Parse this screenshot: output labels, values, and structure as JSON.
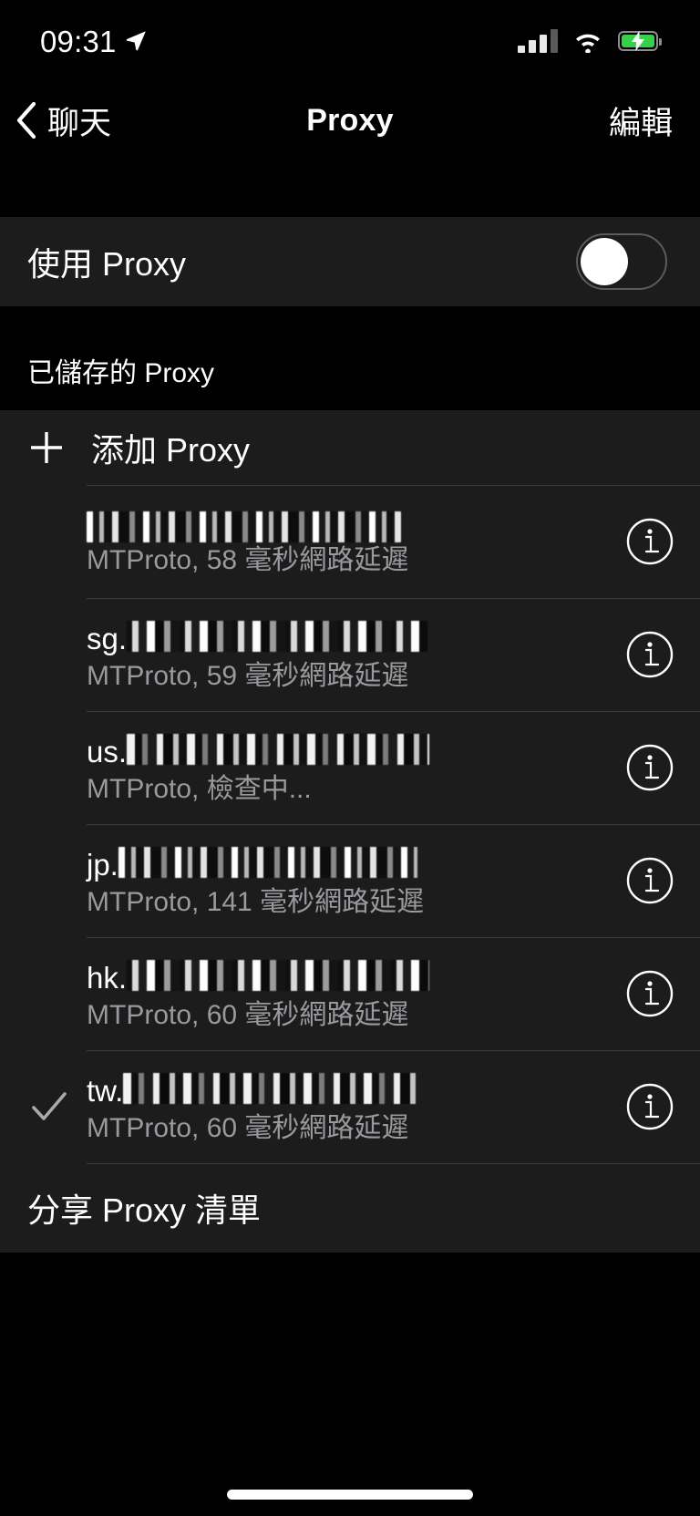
{
  "status_bar": {
    "time": "09:31",
    "location_icon": "location-arrow-icon",
    "signal_icon": "cellular-signal-icon",
    "wifi_icon": "wifi-icon",
    "battery_icon": "battery-charging-icon",
    "battery_color": "#37d04a"
  },
  "nav": {
    "back_label": "聊天",
    "title": "Proxy",
    "edit_label": "編輯"
  },
  "settings": {
    "use_proxy_label": "使用 Proxy",
    "use_proxy_enabled": false
  },
  "saved_section": {
    "header": "已儲存的 Proxy",
    "add_label": "添加 Proxy",
    "add_icon": "plus-icon"
  },
  "proxies": [
    {
      "host_prefix": "",
      "host_redacted": true,
      "host_redacted_width": 345,
      "detail": "MTProto, 58 毫秒網路延遲",
      "selected": false,
      "info_icon": "info-circle-icon"
    },
    {
      "host_prefix": "sg.",
      "host_redacted": true,
      "host_redacted_width": 330,
      "detail": "MTProto, 59 毫秒網路延遲",
      "selected": false,
      "info_icon": "info-circle-icon"
    },
    {
      "host_prefix": "us.",
      "host_redacted": true,
      "host_redacted_width": 332,
      "detail": "MTProto, 檢查中...",
      "selected": false,
      "info_icon": "info-circle-icon"
    },
    {
      "host_prefix": "jp.",
      "host_redacted": true,
      "host_redacted_width": 328,
      "detail": "MTProto, 141 毫秒網路延遲",
      "selected": false,
      "info_icon": "info-circle-icon"
    },
    {
      "host_prefix": "hk.",
      "host_redacted": true,
      "host_redacted_width": 332,
      "detail": "MTProto, 60 毫秒網路延遲",
      "selected": false,
      "info_icon": "info-circle-icon"
    },
    {
      "host_prefix": "tw.",
      "host_redacted": true,
      "host_redacted_width": 322,
      "detail": "MTProto, 60 毫秒網路延遲",
      "selected": true,
      "selected_icon": "checkmark-icon",
      "info_icon": "info-circle-icon"
    }
  ],
  "share": {
    "label": "分享 Proxy 清單"
  },
  "colors": {
    "page_background": "#000000",
    "cell_background": "#1c1c1d",
    "separator": "#3a3a3c",
    "primary_text": "#ffffff",
    "secondary_text": "#9a9a9e"
  }
}
